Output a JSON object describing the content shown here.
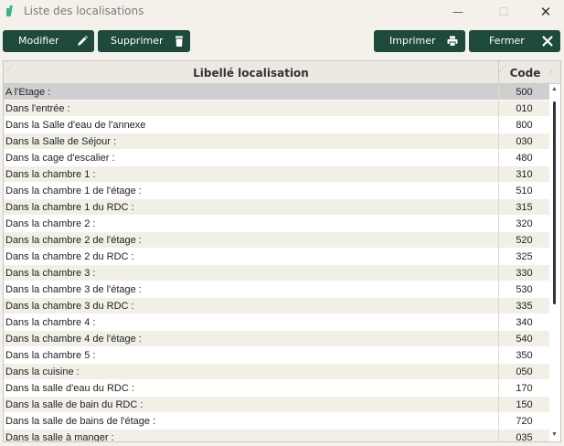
{
  "window": {
    "title": "Liste des localisations",
    "minimize_glyph": "—",
    "maximize_glyph": "☐",
    "close_glyph": "✕"
  },
  "toolbar": {
    "modifier_label": "Modifier",
    "supprimer_label": "Supprimer",
    "imprimer_label": "Imprimer",
    "fermer_label": "Fermer",
    "icons": {
      "modifier": "pencil-icon",
      "supprimer": "trash-icon",
      "imprimer": "printer-icon",
      "fermer": "close-icon"
    },
    "button_color": "#1e4a3c"
  },
  "table": {
    "columns": {
      "libelle": "Libellé localisation",
      "code": "Code"
    },
    "selected_color": "#cfcfcf",
    "alt_row_color": "#f2efe7",
    "rows": [
      {
        "libelle": "A l'Etage :",
        "code": "500",
        "selected": true
      },
      {
        "libelle": "Dans l'entrée :",
        "code": "010"
      },
      {
        "libelle": "Dans la Salle d'eau de l'annexe",
        "code": "800"
      },
      {
        "libelle": "Dans la Salle de Séjour :",
        "code": "030"
      },
      {
        "libelle": "Dans la cage d'escalier :",
        "code": "480"
      },
      {
        "libelle": "Dans la chambre 1 :",
        "code": "310"
      },
      {
        "libelle": "Dans la chambre 1 de l'étage :",
        "code": "510"
      },
      {
        "libelle": "Dans la chambre 1 du RDC :",
        "code": "315"
      },
      {
        "libelle": "Dans la chambre 2 :",
        "code": "320"
      },
      {
        "libelle": "Dans la chambre 2 de l'étage :",
        "code": "520"
      },
      {
        "libelle": "Dans la chambre 2 du RDC :",
        "code": "325"
      },
      {
        "libelle": "Dans la chambre 3 :",
        "code": "330"
      },
      {
        "libelle": "Dans la chambre 3 de l'étage :",
        "code": "530"
      },
      {
        "libelle": "Dans la chambre 3 du RDC :",
        "code": "335"
      },
      {
        "libelle": "Dans la chambre 4 :",
        "code": "340"
      },
      {
        "libelle": "Dans la chambre 4 de l'étage :",
        "code": "540"
      },
      {
        "libelle": "Dans la chambre 5 :",
        "code": "350"
      },
      {
        "libelle": "Dans la cuisine :",
        "code": "050"
      },
      {
        "libelle": "Dans la salle d'eau du RDC :",
        "code": "170"
      },
      {
        "libelle": "Dans la salle de bain du RDC :",
        "code": "150"
      },
      {
        "libelle": "Dans la salle de bains de l'étage :",
        "code": "720"
      },
      {
        "libelle": "Dans la salle à manger :",
        "code": "035"
      }
    ]
  }
}
